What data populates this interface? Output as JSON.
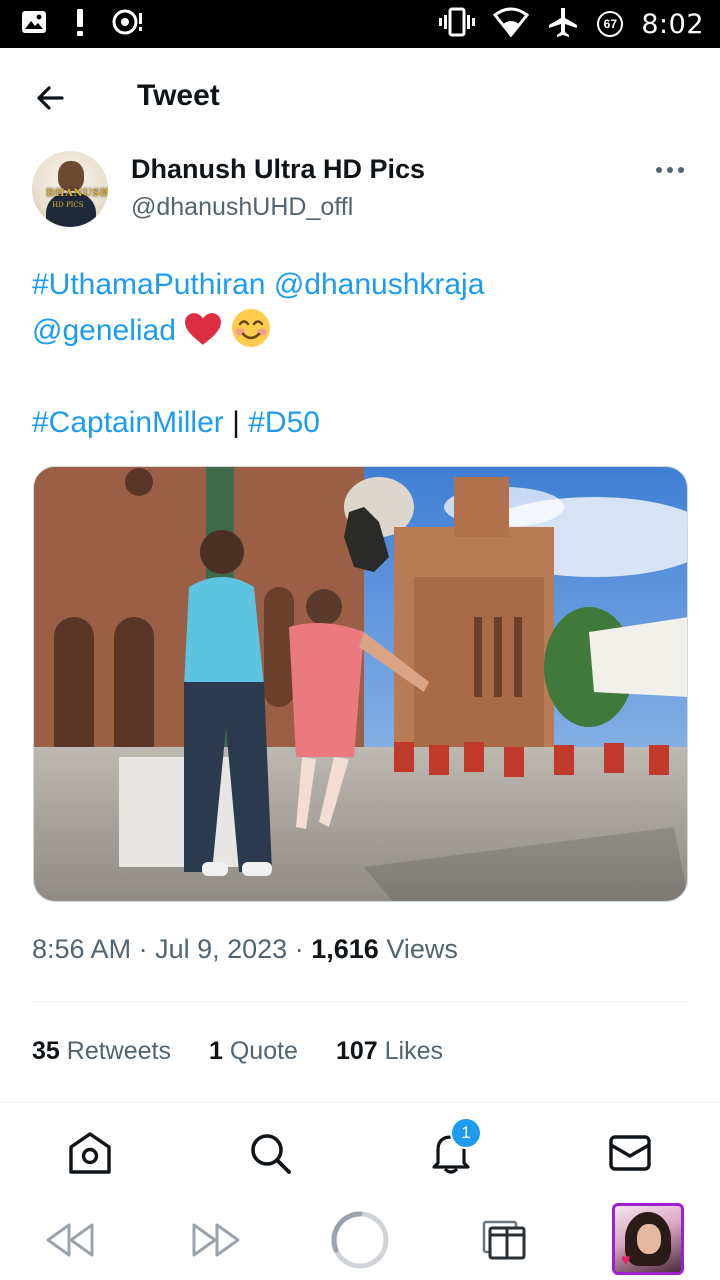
{
  "status_bar": {
    "time": "8:02",
    "battery_level": "67"
  },
  "header": {
    "title": "Tweet"
  },
  "author": {
    "name": "Dhanush Ultra HD Pics",
    "handle": "@dhanushUHD_offl",
    "avatar_text": "DHANUSH",
    "avatar_subtext": "HD PICS"
  },
  "tweet": {
    "line1": [
      {
        "text": "#UthamaPuthiran",
        "type": "hashtag"
      },
      {
        "text": "@dhanushkraja",
        "type": "mention"
      }
    ],
    "line2": [
      {
        "text": "@geneliad",
        "type": "mention"
      }
    ],
    "line3": [
      {
        "text": "#CaptainMiller",
        "type": "hashtag"
      },
      {
        "text": "|",
        "type": "plain"
      },
      {
        "text": "#D50",
        "type": "hashtag"
      }
    ],
    "emojis": [
      "red-heart",
      "smiling-face-with-smiling-eyes"
    ]
  },
  "meta": {
    "time": "8:56 AM",
    "separator": "·",
    "date": "Jul 9, 2023",
    "views_count": "1,616",
    "views_label": "Views"
  },
  "stats": {
    "retweets_count": "35",
    "retweets_label": "Retweets",
    "quotes_count": "1",
    "quotes_label": "Quote",
    "likes_count": "107",
    "likes_label": "Likes"
  },
  "tabbar": {
    "items": [
      "home-icon",
      "search-icon",
      "notifications-icon",
      "messages-icon"
    ],
    "notification_badge": "1"
  },
  "system_nav": {
    "items": [
      "rewind-icon",
      "fast-forward-icon",
      "loading-icon",
      "tabs-icon"
    ]
  },
  "colors": {
    "link": "#1d9bf0",
    "secondary_text": "#536471",
    "primary_text": "#0f1419",
    "divider": "#eff3f4"
  }
}
